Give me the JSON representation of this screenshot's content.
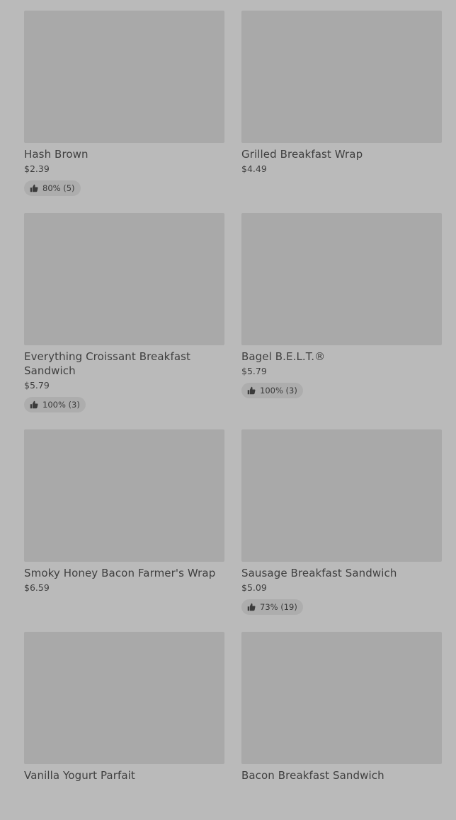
{
  "menu": {
    "items": [
      {
        "name": "Hash Brown",
        "price": "$2.39",
        "rating": "80% (5)"
      },
      {
        "name": "Grilled Breakfast Wrap",
        "price": "$4.49",
        "rating": null
      },
      {
        "name": "Everything Croissant Breakfast Sandwich",
        "price": "$5.79",
        "rating": "100% (3)"
      },
      {
        "name": "Bagel B.E.L.T.®",
        "price": "$5.79",
        "rating": "100% (3)"
      },
      {
        "name": "Smoky Honey Bacon Farmer's Wrap",
        "price": "$6.59",
        "rating": null
      },
      {
        "name": "Sausage Breakfast Sandwich",
        "price": "$5.09",
        "rating": "73% (19)"
      },
      {
        "name": "Vanilla Yogurt Parfait",
        "price": "",
        "rating": null
      },
      {
        "name": "Bacon Breakfast Sandwich",
        "price": "",
        "rating": null
      }
    ]
  },
  "icons": {
    "rating": "thumbs-up-icon"
  }
}
